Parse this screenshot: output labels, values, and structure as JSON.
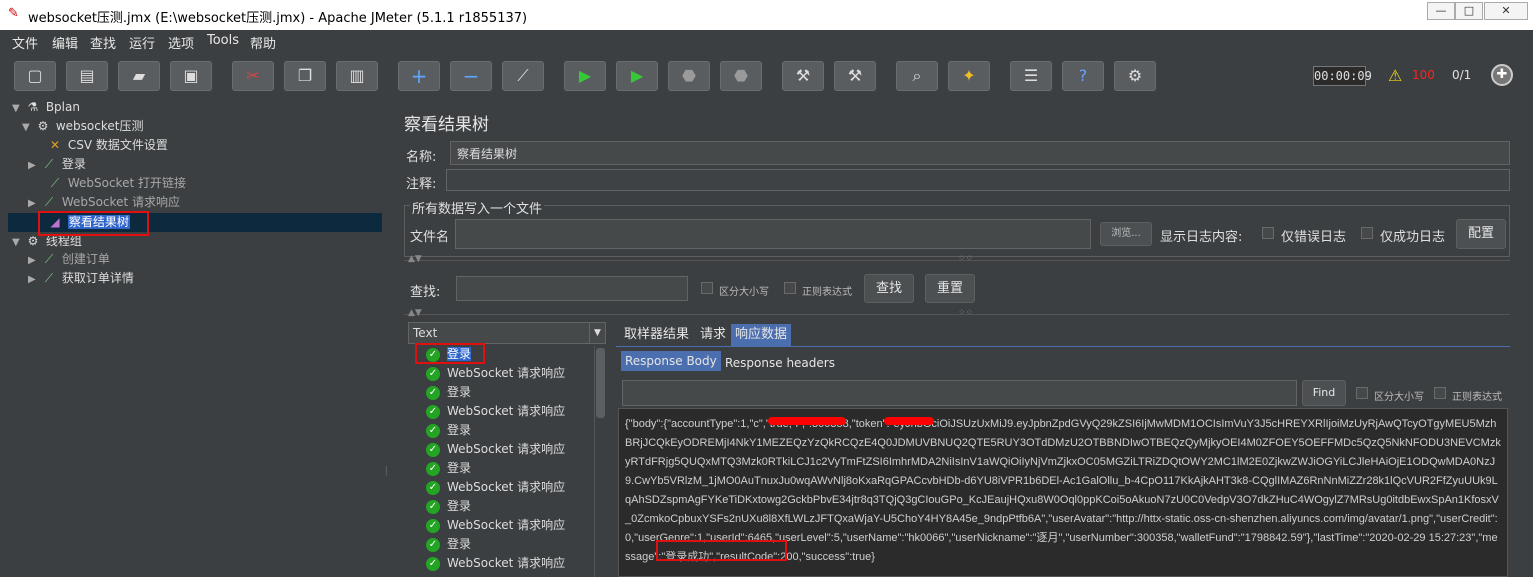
{
  "window": {
    "title": "websocket压测.jmx (E:\\websocket压测.jmx) - Apache JMeter (5.1.1 r1855137)",
    "minimize": "—",
    "maximize": "□",
    "close": "✕"
  },
  "menu": [
    "文件",
    "编辑",
    "查找",
    "运行",
    "选项",
    "Tools",
    "帮助"
  ],
  "toolbar": {
    "timer": "00:00:09",
    "errors": "100",
    "threads": "0/1"
  },
  "tree": {
    "nodes": [
      {
        "label": "Bplan"
      },
      {
        "label": "websocket压测"
      },
      {
        "label": "CSV 数据文件设置"
      },
      {
        "label": "登录"
      },
      {
        "label": "WebSocket 打开链接"
      },
      {
        "label": "WebSocket 请求响应"
      },
      {
        "label": "察看结果树"
      },
      {
        "label": "线程组"
      },
      {
        "label": "创建订单"
      },
      {
        "label": "获取订单详情"
      }
    ]
  },
  "panel": {
    "title": "察看结果树",
    "name_label": "名称:",
    "name_value": "察看结果树",
    "comment_label": "注释:",
    "group_title": "所有数据写入一个文件",
    "file_label": "文件名",
    "browse": "浏览...",
    "log_label": "显示日志内容:",
    "errors_only": "仅错误日志",
    "success_only": "仅成功日志",
    "config": "配置",
    "search_label": "查找:",
    "case_sensitive": "区分大小写",
    "regex": "正则表达式",
    "search_btn": "查找",
    "reset_btn": "重置"
  },
  "results": {
    "renderer": "Text",
    "items": [
      "登录",
      "WebSocket 请求响应",
      "登录",
      "WebSocket 请求响应",
      "登录",
      "WebSocket 请求响应",
      "登录",
      "WebSocket 请求响应",
      "登录",
      "WebSocket 请求响应",
      "登录",
      "WebSocket 请求响应"
    ]
  },
  "tabs": {
    "sampler": "取样器结果",
    "request": "请求",
    "response": "响应数据",
    "body": "Response Body",
    "headers": "Response headers",
    "find": "Find",
    "case_sensitive": "区分大小写",
    "regex": "正则表达式"
  },
  "response": {
    "text": "{\"body\":{\"accountType\":1,\"c\",\"true,\"i\",\":300358,\"token\":\"eyJhbGciOiJSUzUxMiJ9.eyJpbnZpdGVyQ29kZSI6IjMwMDM1OCIsImVuY3J5cHREYXRlIjoiMzUyRjAwQTcyOTgyMEU5MzhBRjJCQkEyODREMjI4NkY1MEZEQzYzQkRCQzE4Q0JDMUVBNUQ2QTE5RUY3OTdDMzU2OTBBNDIwOTBEQzQyMjkyOEI4M0ZFOEY5OEFFMDc5QzQ5NkNFODU3NEVCMzkyRTdFRjg5QUQxMTQ3Mzk0RTkiLCJ1c2VyTmFtZSI6ImhrMDA2NiIsInV1aWQiOiIyNjVmZjkxOC05MGZiLTRiZDQtOWY2MC1lM2E0ZjkwZWJiOGYiLCJleHAiOjE1ODQwMDA0NzJ9.CwYb5VRlzM_1jMO0AuTnuxJu0wqAWvNlj8oKxaRqGPACcvbHDb-d6YU8iVPR1b6DEl-Ac1GalOllu_b-4CpO117KkAjkAHT3k8-CQglIMAZ6RnNnMiZZr28k1lQcVUR2FfZyuUUk9LqAhSDZspmAgFYKeTiDKxtowg2GckbPbvE34jtr8q3TQjQ3gCIouGPo_KcJEaujHQxu8W0Oql0ppKCoi5oAkuoN7zU0C0VedpV3O7dkZHuC4WOgylZ7MRsUg0itdbEwxSpAn1KfosxV_0ZcmkoCpbuxYSFs2nUXu8l8XfLWLzJFTQxaWjaY-U5ChoY4HY8A45e_9ndpPtfb6A\",\"userAvatar\":\"http://httx-static.oss-cn-shenzhen.aliyuncs.com/img/avatar/1.png\",\"userCredit\":0,\"userGenre\":1,\"userId\":6465,\"userLevel\":5,\"userName\":\"hk0066\",\"userNickname\":\"逐月\",\"userNumber\":300358,\"walletFund\":\"1798842.59\"},\"lastTime\":\"2020-02-29 15:27:23\",\"message\":\"登录成功\",\"resultCode\":200,\"success\":true}"
  }
}
